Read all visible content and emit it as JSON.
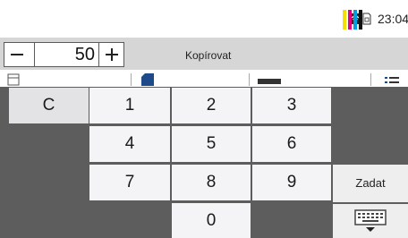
{
  "status_bar": {
    "time": "23:04",
    "wifi_icon": "wifi-icon",
    "sd_icon": "sd-card-icon",
    "toner_colors": [
      "#f4e000",
      "#e5007e",
      "#00a0e0",
      "#111111"
    ]
  },
  "copies": {
    "minus_label": "minus-icon",
    "value": "50",
    "plus_label": "plus-icon"
  },
  "header": {
    "title": "Kopírovat"
  },
  "keypad": {
    "clear_label": "C",
    "digits": [
      "1",
      "2",
      "3",
      "4",
      "5",
      "6",
      "7",
      "8",
      "9",
      "0"
    ],
    "enter_label": "Zadat",
    "keyboard_icon": "keyboard-icon"
  }
}
